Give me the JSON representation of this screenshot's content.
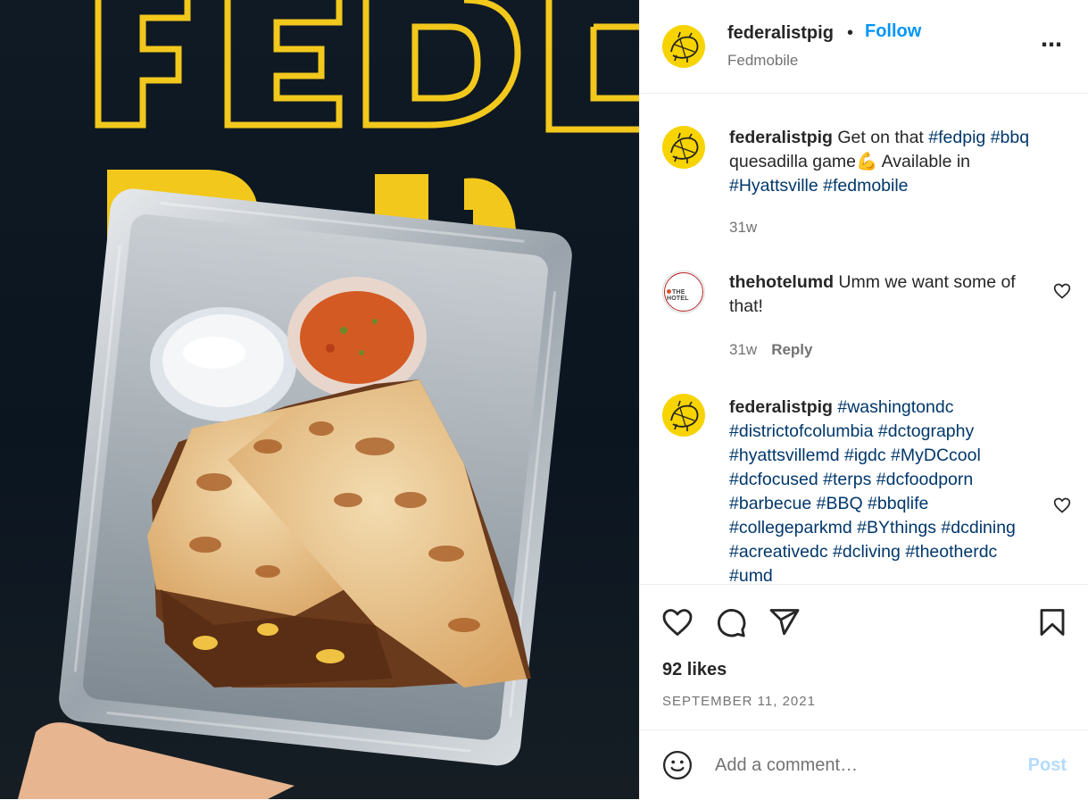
{
  "post": {
    "photo_alt": "Photo by federalistpig",
    "truck_lettering": [
      "FEDE",
      "PIG"
    ]
  },
  "header": {
    "username": "federalistpig",
    "separator": "•",
    "follow_label": "Follow",
    "location": "Fedmobile",
    "more_icon": "⋯"
  },
  "caption": {
    "username": "federalistpig",
    "parts": [
      {
        "t": " Get on that "
      },
      {
        "t": "#fedpig",
        "tag": true
      },
      {
        "t": " "
      },
      {
        "t": "#bbq",
        "tag": true
      },
      {
        "t": " quesadilla game💪 Available in "
      },
      {
        "t": "#Hyattsville",
        "tag": true
      },
      {
        "t": " "
      },
      {
        "t": "#fedmobile",
        "tag": true
      }
    ],
    "time": "31w"
  },
  "comment1": {
    "username": "thehotelumd",
    "text": " Umm we want some of that!",
    "time": "31w",
    "reply_label": "Reply",
    "avatar_text": "THE HOTEL"
  },
  "comment2": {
    "username": "federalistpig",
    "tags": [
      "#washingtondc",
      "#districtofcolumbia",
      "#dctography",
      "#hyattsvillemd",
      "#igdc",
      "#MyDCcool",
      "#dcfocused",
      "#terps",
      "#dcfoodporn",
      "#barbecue",
      "#BBQ",
      "#bbqlife",
      "#collegeparkmd",
      "#BYthings",
      "#dcdining",
      "#acreativedc",
      "#dcliving",
      "#theotherdc",
      "#umd"
    ]
  },
  "actions": {
    "likes": "92 likes",
    "date": "SEPTEMBER 11, 2021",
    "comment_placeholder": "Add a comment…",
    "post_label": "Post"
  },
  "colors": {
    "follow": "#0095f6",
    "hashtag": "#00376b",
    "avatar_bg": "#f7d300",
    "post_disabled": "#b3dbff",
    "truck_yellow": "#f2c81c"
  }
}
